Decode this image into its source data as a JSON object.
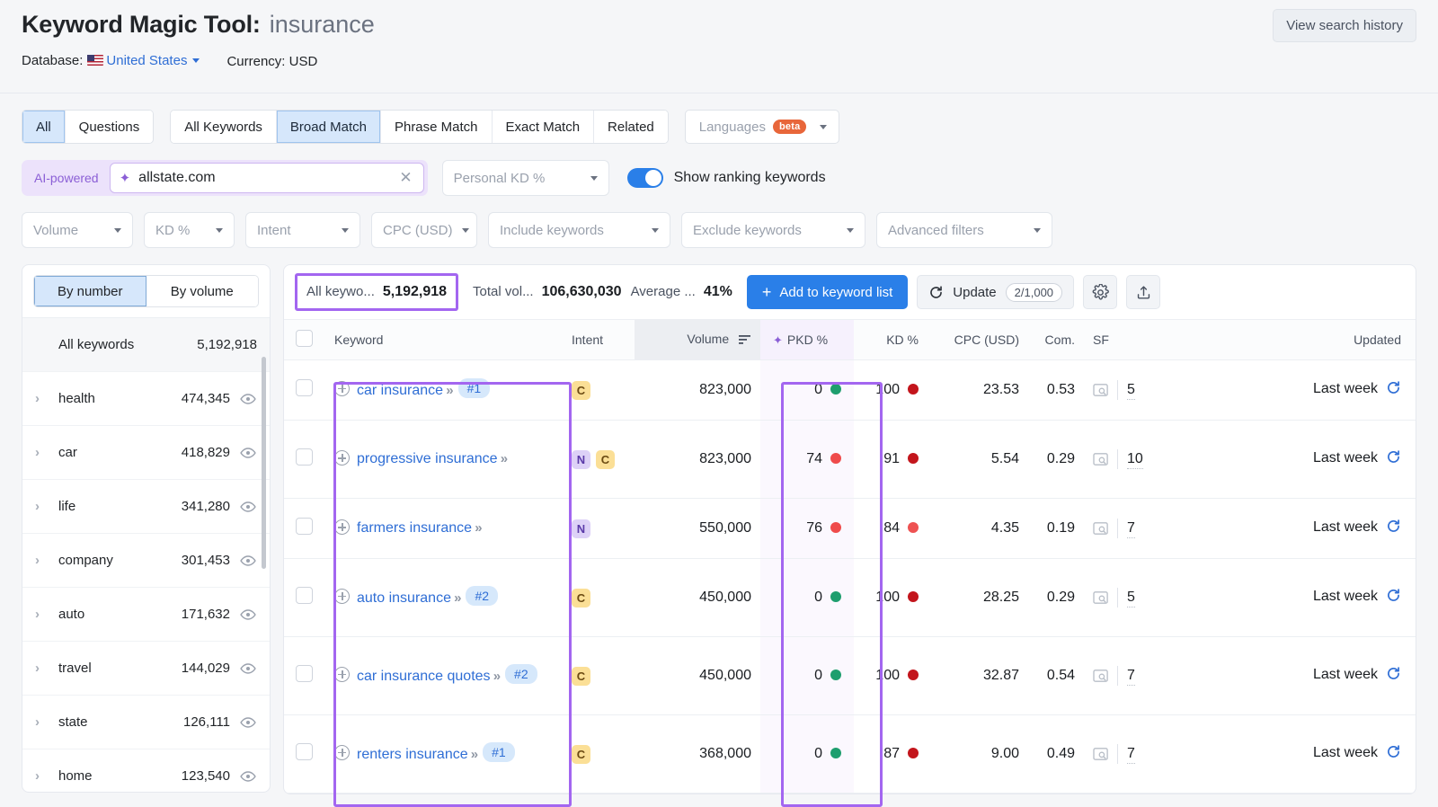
{
  "header": {
    "title_main": "Keyword Magic Tool:",
    "title_query": "insurance",
    "database_label": "Database:",
    "database_value": "United States",
    "currency": "Currency: USD",
    "view_history": "View search history"
  },
  "match_tabs": {
    "group1": [
      {
        "label": "All",
        "active": true
      },
      {
        "label": "Questions",
        "active": false
      }
    ],
    "group2": [
      {
        "label": "All Keywords",
        "active": false
      },
      {
        "label": "Broad Match",
        "active": true
      },
      {
        "label": "Phrase Match",
        "active": false
      },
      {
        "label": "Exact Match",
        "active": false
      },
      {
        "label": "Related",
        "active": false
      }
    ],
    "languages": {
      "label": "Languages",
      "badge": "beta"
    }
  },
  "ai_search": {
    "tag": "AI-powered",
    "value": "allstate.com",
    "clear_icon": "close-icon",
    "sparkle_icon": "sparkle-icon"
  },
  "personal_kd": "Personal KD %",
  "ranking_toggle": {
    "label": "Show ranking keywords",
    "on": true
  },
  "filters": [
    "Volume",
    "KD %",
    "Intent",
    "CPC (USD)",
    "Include keywords",
    "Exclude keywords",
    "Advanced filters"
  ],
  "sidebar": {
    "segments": [
      {
        "label": "By number",
        "active": true
      },
      {
        "label": "By volume",
        "active": false
      }
    ],
    "all_row": {
      "label": "All keywords",
      "count": "5,192,918"
    },
    "items": [
      {
        "label": "health",
        "count": "474,345"
      },
      {
        "label": "car",
        "count": "418,829"
      },
      {
        "label": "life",
        "count": "341,280"
      },
      {
        "label": "company",
        "count": "301,453"
      },
      {
        "label": "auto",
        "count": "171,632"
      },
      {
        "label": "travel",
        "count": "144,029"
      },
      {
        "label": "state",
        "count": "126,111"
      },
      {
        "label": "home",
        "count": "123,540"
      }
    ]
  },
  "toolbar": {
    "all_keywords_label": "All keywo...",
    "all_keywords_value": "5,192,918",
    "total_volume_label": "Total vol...",
    "total_volume_value": "106,630,030",
    "average_label": "Average ...",
    "average_value": "41%",
    "add_button": "Add to keyword list",
    "update_button": "Update",
    "update_chip": "2/1,000",
    "settings_icon": "gear-icon",
    "export_icon": "export-icon"
  },
  "table": {
    "columns": [
      "Keyword",
      "Intent",
      "Volume",
      "PKD %",
      "KD %",
      "CPC (USD)",
      "Com.",
      "SF",
      "Updated"
    ],
    "rows": [
      {
        "keyword": "car insurance",
        "rank": "#1",
        "tall": false,
        "intent": [
          "C"
        ],
        "volume": "823,000",
        "pkd": "0",
        "pkd_color": "#1e9e6e",
        "kd": "100",
        "kd_color": "#c3151c",
        "cpc": "23.53",
        "com": "0.53",
        "sf": "5",
        "updated": "Last week"
      },
      {
        "keyword": "progressive insurance",
        "rank": "",
        "tall": true,
        "intent": [
          "N",
          "C"
        ],
        "volume": "823,000",
        "pkd": "74",
        "pkd_color": "#ef4b4b",
        "kd": "91",
        "kd_color": "#c3151c",
        "cpc": "5.54",
        "com": "0.29",
        "sf": "10",
        "updated": "Last week"
      },
      {
        "keyword": "farmers insurance",
        "rank": "",
        "tall": false,
        "intent": [
          "N"
        ],
        "volume": "550,000",
        "pkd": "76",
        "pkd_color": "#ef4b4b",
        "kd": "84",
        "kd_color": "#ee5252",
        "cpc": "4.35",
        "com": "0.19",
        "sf": "7",
        "updated": "Last week"
      },
      {
        "keyword": "auto insurance",
        "rank": "#2",
        "tall": true,
        "intent": [
          "C"
        ],
        "volume": "450,000",
        "pkd": "0",
        "pkd_color": "#1e9e6e",
        "kd": "100",
        "kd_color": "#c3151c",
        "cpc": "28.25",
        "com": "0.29",
        "sf": "5",
        "updated": "Last week"
      },
      {
        "keyword": "car insurance quotes",
        "rank": "#2",
        "tall": true,
        "intent": [
          "C"
        ],
        "volume": "450,000",
        "pkd": "0",
        "pkd_color": "#1e9e6e",
        "kd": "100",
        "kd_color": "#c3151c",
        "cpc": "32.87",
        "com": "0.54",
        "sf": "7",
        "updated": "Last week"
      },
      {
        "keyword": "renters insurance",
        "rank": "#1",
        "tall": true,
        "intent": [
          "C"
        ],
        "volume": "368,000",
        "pkd": "0",
        "pkd_color": "#1e9e6e",
        "kd": "87",
        "kd_color": "#c3151c",
        "cpc": "9.00",
        "com": "0.49",
        "sf": "7",
        "updated": "Last week"
      }
    ]
  },
  "colors": {
    "accent_blue": "#2a7fe8",
    "highlight_purple": "#a366f0",
    "pkd_purple": "#8b5fd6"
  }
}
